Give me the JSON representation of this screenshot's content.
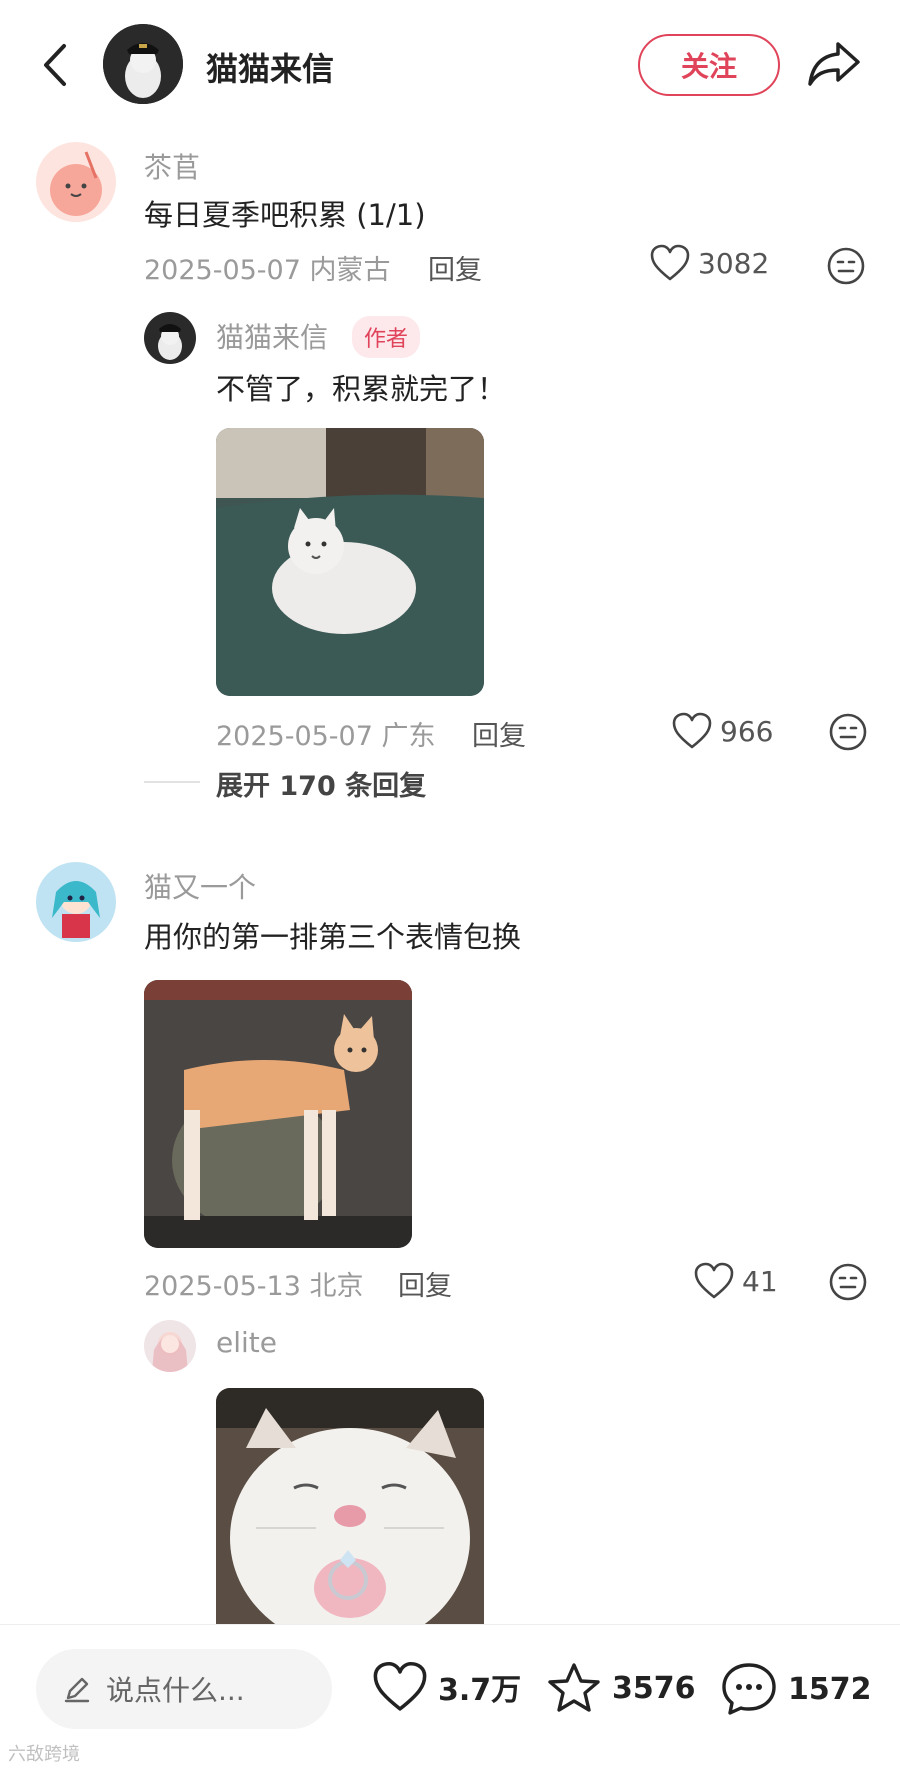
{
  "header": {
    "title": "猫猫来信",
    "follow_label": "关注"
  },
  "comments": [
    {
      "username": "苶苢",
      "text": "每日夏季吧积累 (1/1)",
      "date_location": "2025-05-07 内蒙古",
      "reply_label": "回复",
      "likes": "3082",
      "replies": [
        {
          "username": "猫猫来信",
          "badge": "作者",
          "text": "不管了，积累就完了！",
          "date_location": "2025-05-07 广东",
          "reply_label": "回复",
          "likes": "966"
        }
      ],
      "expand_label": "展开 170 条回复"
    },
    {
      "username": "猫又一个",
      "text": "用你的第一排第三个表情包换",
      "date_location": "2025-05-13 北京",
      "reply_label": "回复",
      "likes": "41",
      "replies": [
        {
          "username": "elite"
        }
      ]
    }
  ],
  "bottom_bar": {
    "input_placeholder": "说点什么...",
    "likes": "3.7万",
    "favorites": "3576",
    "comments": "1572"
  },
  "watermark": "六敌跨境",
  "colors": {
    "accent": "#e0445a",
    "muted": "#9a9a9a"
  }
}
